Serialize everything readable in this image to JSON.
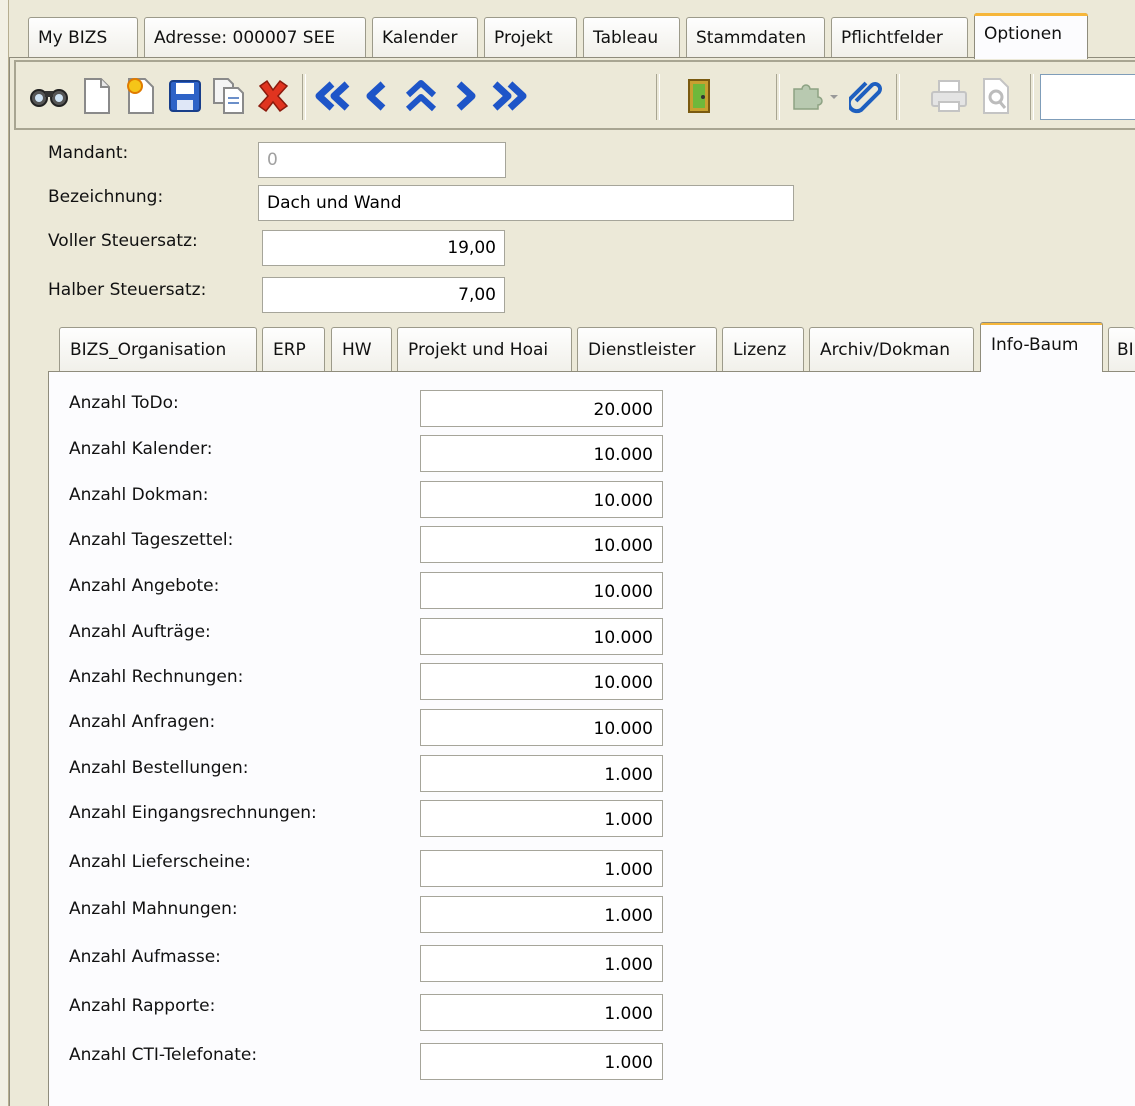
{
  "top_tabs": [
    {
      "label": "My BIZS"
    },
    {
      "label": "Adresse: 000007 SEE"
    },
    {
      "label": "Kalender"
    },
    {
      "label": "Projekt"
    },
    {
      "label": "Tableau"
    },
    {
      "label": "Stammdaten"
    },
    {
      "label": "Pflichtfelder"
    },
    {
      "label": "Optionen",
      "active": true
    }
  ],
  "toolbar": {
    "buttons": [
      "binoculars-icon",
      "new-document-icon",
      "new-star-document-icon",
      "save-icon",
      "copy-icon",
      "delete-icon",
      "first-record-icon",
      "previous-record-icon",
      "up-record-icon",
      "next-record-icon",
      "last-record-icon",
      "exit-door-icon",
      "puzzle-dropdown-icon",
      "paperclip-icon",
      "print-icon",
      "print-preview-icon"
    ],
    "search_value": ""
  },
  "header_form": {
    "mandant": {
      "label": "Mandant:",
      "value": "0"
    },
    "bezeichnung": {
      "label": "Bezeichnung:",
      "value": "Dach und Wand"
    },
    "voller": {
      "label": "Voller Steuersatz:",
      "value": "19,00"
    },
    "halber": {
      "label": "Halber Steuersatz:",
      "value": "7,00"
    }
  },
  "inner_tabs": [
    {
      "label": "BIZS_Organisation"
    },
    {
      "label": "ERP"
    },
    {
      "label": "HW"
    },
    {
      "label": "Projekt und Hoai"
    },
    {
      "label": "Dienstleister"
    },
    {
      "label": "Lizenz"
    },
    {
      "label": "Archiv/Dokman"
    },
    {
      "label": "Info-Baum",
      "active": true
    },
    {
      "label": "BI"
    }
  ],
  "info_baum": [
    {
      "label": "Anzahl ToDo:",
      "value": "20.000"
    },
    {
      "label": "Anzahl Kalender:",
      "value": "10.000"
    },
    {
      "label": "Anzahl Dokman:",
      "value": "10.000"
    },
    {
      "label": "Anzahl Tageszettel:",
      "value": "10.000"
    },
    {
      "label": "Anzahl Angebote:",
      "value": "10.000"
    },
    {
      "label": "Anzahl Aufträge:",
      "value": "10.000"
    },
    {
      "label": "Anzahl Rechnungen:",
      "value": "10.000"
    },
    {
      "label": "Anzahl Anfragen:",
      "value": "10.000"
    },
    {
      "label": "Anzahl Bestellungen:",
      "value": "1.000"
    },
    {
      "label": "Anzahl Eingangsrechnungen:",
      "value": "1.000"
    },
    {
      "label": "Anzahl Lieferscheine:",
      "value": "1.000"
    },
    {
      "label": "Anzahl Mahnungen:",
      "value": "1.000"
    },
    {
      "label": "Anzahl Aufmasse:",
      "value": "1.000"
    },
    {
      "label": "Anzahl Rapporte:",
      "value": "1.000"
    },
    {
      "label": "Anzahl CTI-Telefonate:",
      "value": "1.000"
    }
  ]
}
